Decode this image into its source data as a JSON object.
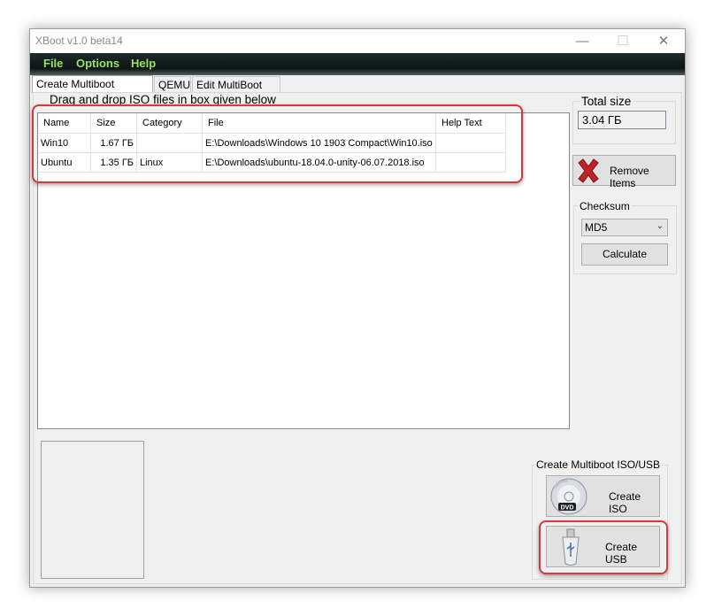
{
  "window": {
    "title": "XBoot v1.0 beta14",
    "controls": {
      "minimize": "—",
      "maximize": "☐",
      "close": "✕"
    }
  },
  "menu": [
    "File",
    "Options",
    "Help"
  ],
  "tabs": [
    "Create Multiboot USB/ISO",
    "QEMU",
    "Edit MultiBoot USB"
  ],
  "iso_list": {
    "instruction": "Drag and drop ISO files in box given below",
    "columns": [
      "Name",
      "Size",
      "Category",
      "File",
      "Help Text"
    ],
    "rows": [
      {
        "name": "Win10",
        "size": "1.67 ГБ",
        "category": "",
        "file": "E:\\Downloads\\Windows 10 1903 Compact\\Win10.iso",
        "help": ""
      },
      {
        "name": "Ubuntu",
        "size": "1.35 ГБ",
        "category": "Linux",
        "file": "E:\\Downloads\\ubuntu-18.04.0-unity-06.07.2018.iso",
        "help": ""
      }
    ]
  },
  "total_size": {
    "label": "Total size",
    "value": "3.04 ГБ"
  },
  "remove_button": {
    "label": "Remove Items",
    "icon": "red-x-icon"
  },
  "checksum": {
    "label": "Checksum",
    "selected": "MD5",
    "calculate_label": "Calculate"
  },
  "create": {
    "group_label": "Create Multiboot ISO/USB",
    "iso_label": "Create ISO",
    "usb_label": "Create USB",
    "iso_icon": "dvd-icon",
    "usb_icon": "usb-drive-icon"
  },
  "colors": {
    "menu_text": "#9be35e",
    "highlight": "#d9363e",
    "remove_x": "#c0222a"
  }
}
